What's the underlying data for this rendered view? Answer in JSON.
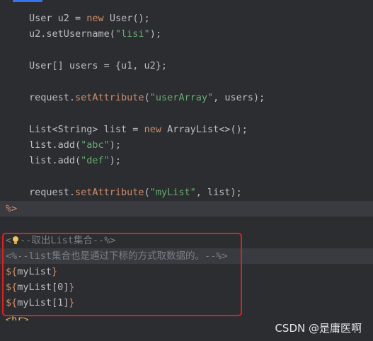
{
  "code": {
    "l1": {
      "cls": "User",
      "var": " u2 = ",
      "kw": "new",
      "rest": " User();"
    },
    "l2": {
      "pre": "u2.setUsername(",
      "str": "\"lisi\"",
      "post": ");"
    },
    "l3": {
      "text": "User[] users = {u1, u2};"
    },
    "l4": {
      "pre": "request.",
      "mth": "setAttribute",
      "open": "(",
      "str": "\"userArray\"",
      "post": ", users);"
    },
    "l5": {
      "pre": "List<String> list = ",
      "kw": "new",
      "post": " ArrayList<>();"
    },
    "l6": {
      "pre": "list.add(",
      "str": "\"abc\"",
      "post": ");"
    },
    "l7": {
      "pre": "list.add(",
      "str": "\"def\"",
      "post": ");"
    },
    "l8": {
      "pre": "request.",
      "mth": "setAttribute",
      "open": "(",
      "str": "\"myList\"",
      "post": ", list);"
    },
    "l9": {
      "text": "%>"
    },
    "c1": {
      "pre": "<",
      "post": "--取出List集合--%>"
    },
    "c2": {
      "text": "<%--list集合也是通过下标的方式取数据的。--%>"
    },
    "e1": {
      "open": "${",
      "expr": "myList",
      "close": "}"
    },
    "e2": {
      "open": "${",
      "expr": "myList[0]",
      "close": "}"
    },
    "e3": {
      "open": "${",
      "expr": "myList[1]",
      "close": "}"
    },
    "partial": {
      "text": "<hr>"
    }
  },
  "watermark": {
    "text": "CSDN @是庸医啊"
  },
  "icons": {
    "intention": "lightbulb-icon"
  },
  "colors": {
    "background": "#2b2d30",
    "highlight": "#e0201e",
    "keyword": "#cf8e6d",
    "string": "#6aab73",
    "method": "#56a8f5"
  }
}
